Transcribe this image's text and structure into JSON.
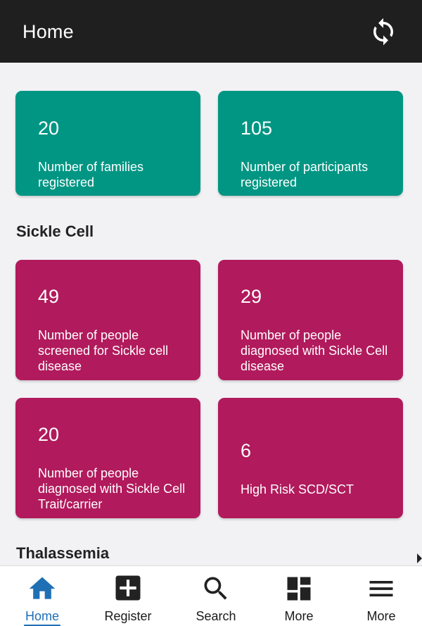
{
  "header": {
    "title": "Home",
    "sync_icon": "sync-icon"
  },
  "summary_cards": [
    {
      "value": "20",
      "label": "Number of families registered"
    },
    {
      "value": "105",
      "label": "Number of participants registered"
    }
  ],
  "sickle_cell": {
    "heading": "Sickle Cell",
    "cards": [
      {
        "value": "49",
        "label": "Number of people screened for Sickle cell disease"
      },
      {
        "value": "29",
        "label": "Number of people diagnosed with Sickle Cell disease"
      },
      {
        "value": "20",
        "label": "Number of people diagnosed with Sickle Cell Trait/carrier"
      },
      {
        "value": "6",
        "label": "High Risk SCD/SCT"
      }
    ]
  },
  "thalassemia": {
    "heading": "Thalassemia"
  },
  "bottom_nav": {
    "items": [
      {
        "label": "Home",
        "icon": "home-icon",
        "active": true
      },
      {
        "label": "Register",
        "icon": "plus-square-icon",
        "active": false
      },
      {
        "label": "Search",
        "icon": "search-icon",
        "active": false
      },
      {
        "label": "More",
        "icon": "dashboard-icon",
        "active": false
      },
      {
        "label": "More",
        "icon": "menu-icon",
        "active": false
      }
    ]
  },
  "colors": {
    "header_bg": "#1f1f1f",
    "summary_card": "#009683",
    "sickle_card": "#b11a5c",
    "active_nav": "#1f6fb5"
  }
}
